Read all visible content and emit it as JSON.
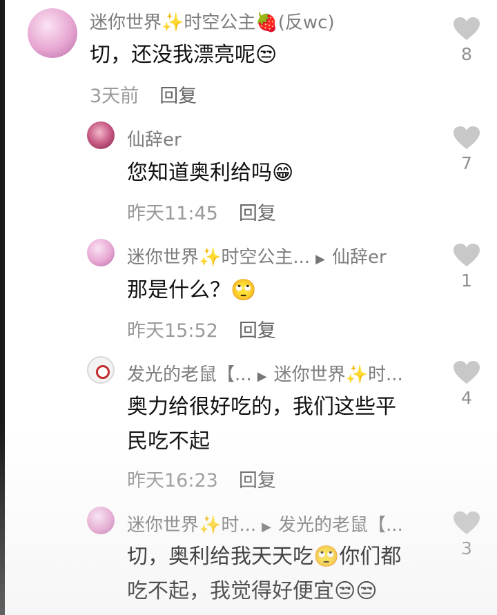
{
  "comments": [
    {
      "name": "迷你世界✨时空公主🍓(反wc)",
      "text": "切，还没我漂亮呢😒",
      "time": "3天前",
      "reply": "回复",
      "likes": "8"
    },
    {
      "name": "仙辞er",
      "text": "您知道奥利给吗😁",
      "time": "昨天11:45",
      "reply": "回复",
      "likes": "7"
    },
    {
      "name": "迷你世界✨时空公主...",
      "reply_to": "仙辞er",
      "text": "那是什么？🙄",
      "time": "昨天15:52",
      "reply": "回复",
      "likes": "1"
    },
    {
      "name": "发光的老鼠【...",
      "reply_to": "迷你世界✨时...",
      "text": "奥力给很好吃的，我们这些平\n民吃不起",
      "time": "昨天16:23",
      "reply": "回复",
      "likes": "4"
    },
    {
      "name": "迷你世界✨时...",
      "reply_to": "发光的老鼠【...",
      "text": "切，奥利给我天天吃🙄你们都\n吃不起，我觉得好便宜😒😒",
      "likes": "3"
    }
  ],
  "icons": {
    "like": "heart-icon",
    "reply_arrow": "triangle-right-icon"
  },
  "colors": {
    "heart": "#c8c8c8",
    "name": "#7d7d7d",
    "meta": "#9a9a9a"
  }
}
